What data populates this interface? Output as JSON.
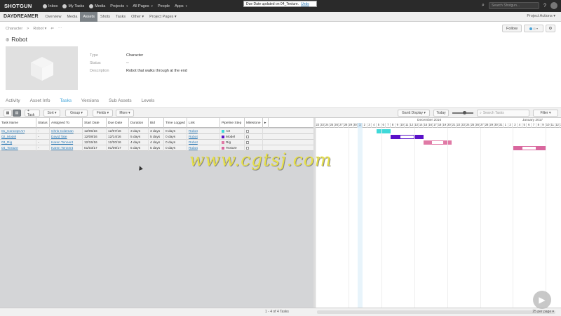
{
  "topbar": {
    "logo": "SHOTGUN",
    "nav": [
      {
        "label": "Inbox",
        "icon": "inbox-icon"
      },
      {
        "label": "My Tasks",
        "icon": "tasks-icon"
      },
      {
        "label": "Media",
        "icon": "media-icon"
      },
      {
        "label": "Projects",
        "caret": true
      },
      {
        "label": "All Pages",
        "caret": true
      },
      {
        "label": "People"
      },
      {
        "label": "Apps",
        "caret": true
      }
    ],
    "notification": {
      "text": "Due Date updated on 04_Texture.",
      "undo": "Undo"
    },
    "search_placeholder": "Search Shotgun..."
  },
  "projectbar": {
    "name": "DAYDREAMER",
    "tabs": [
      "Overview",
      "Media",
      "Assets",
      "Shots",
      "Tasks",
      "Other ▾",
      "Project Pages ▾"
    ],
    "active_tab": "Assets",
    "actions": "Project Actions ▾"
  },
  "breadcrumb": {
    "type": "Character",
    "sep": ">",
    "item": "Robot ▾",
    "back": "⇐",
    "more": "⋯"
  },
  "page_title": "Robot",
  "follow_label": "Follow",
  "details": {
    "type_label": "Type",
    "type_value": "Character",
    "status_label": "Status",
    "status_value": "--",
    "desc_label": "Description",
    "desc_value": "Robot that walks through at the end"
  },
  "tabs": [
    "Activity",
    "Asset Info",
    "Tasks",
    "Versions",
    "Sub Assets",
    "Levels"
  ],
  "active_tab": "Tasks",
  "toolbar": {
    "task": "+ Task",
    "sort": "Sort ▾",
    "group": "Group ▾",
    "fields": "Fields ▾",
    "more": "More ▾",
    "gantt": "Gantt Display ▾",
    "today": "Today",
    "search": "Search Tasks",
    "filter": "Filter ▾"
  },
  "columns": [
    "Task Name",
    "Status",
    "Assigned To",
    "Start Date",
    "Due Date",
    "Duration",
    "Bid",
    "Time Logged",
    "Link",
    "Pipeline Step",
    "Milestone",
    "▸"
  ],
  "rows": [
    {
      "name": "01_Concept Art",
      "status": "-",
      "assigned": "Chris Coleman",
      "start": "12/05/16",
      "due": "12/07/16",
      "duration": "3 days",
      "bid": "3 days",
      "logged": "0 days",
      "link": "Robot",
      "step": "Art",
      "color": "#3fd9d9"
    },
    {
      "name": "02_Model",
      "status": "-",
      "assigned": "David Tate",
      "start": "12/08/16",
      "due": "12/14/16",
      "duration": "5 days",
      "bid": "5 days",
      "logged": "0 days",
      "link": "Robot",
      "step": "Model",
      "color": "#5a12c9"
    },
    {
      "name": "03_Rig",
      "status": "-",
      "assigned": "Karen Tennent",
      "start": "12/15/16",
      "due": "12/20/16",
      "duration": "4 days",
      "bid": "4 days",
      "logged": "0 days",
      "link": "Robot",
      "step": "Rig",
      "color": "#e07aa6"
    },
    {
      "name": "04_Texture",
      "status": "-",
      "assigned": "Karen Tennent",
      "start": "01/03/17",
      "due": "01/09/17",
      "duration": "5 days",
      "bid": "5 days",
      "logged": "0 days",
      "link": "Robot",
      "step": "Texture",
      "color": "#d9679e"
    }
  ],
  "gantt": {
    "month_dec": "December 2016",
    "month_jan": "January 2017",
    "days": [
      "22",
      "23",
      "24",
      "25",
      "26",
      "27",
      "28",
      "29",
      "30",
      "1",
      "2",
      "3",
      "4",
      "5",
      "6",
      "7",
      "8",
      "9",
      "10",
      "11",
      "12",
      "13",
      "14",
      "15",
      "16",
      "17",
      "18",
      "19",
      "20",
      "21",
      "22",
      "23",
      "24",
      "25",
      "26",
      "27",
      "28",
      "29",
      "30",
      "31",
      "1",
      "2",
      "3",
      "4",
      "5",
      "6",
      "7",
      "8",
      "9",
      "10",
      "11",
      "12",
      "13"
    ]
  },
  "footer": {
    "count": "1 - 4 of 4 Tasks",
    "per_page": "25 per page ▾"
  },
  "watermark": "www.cgtsj.com"
}
